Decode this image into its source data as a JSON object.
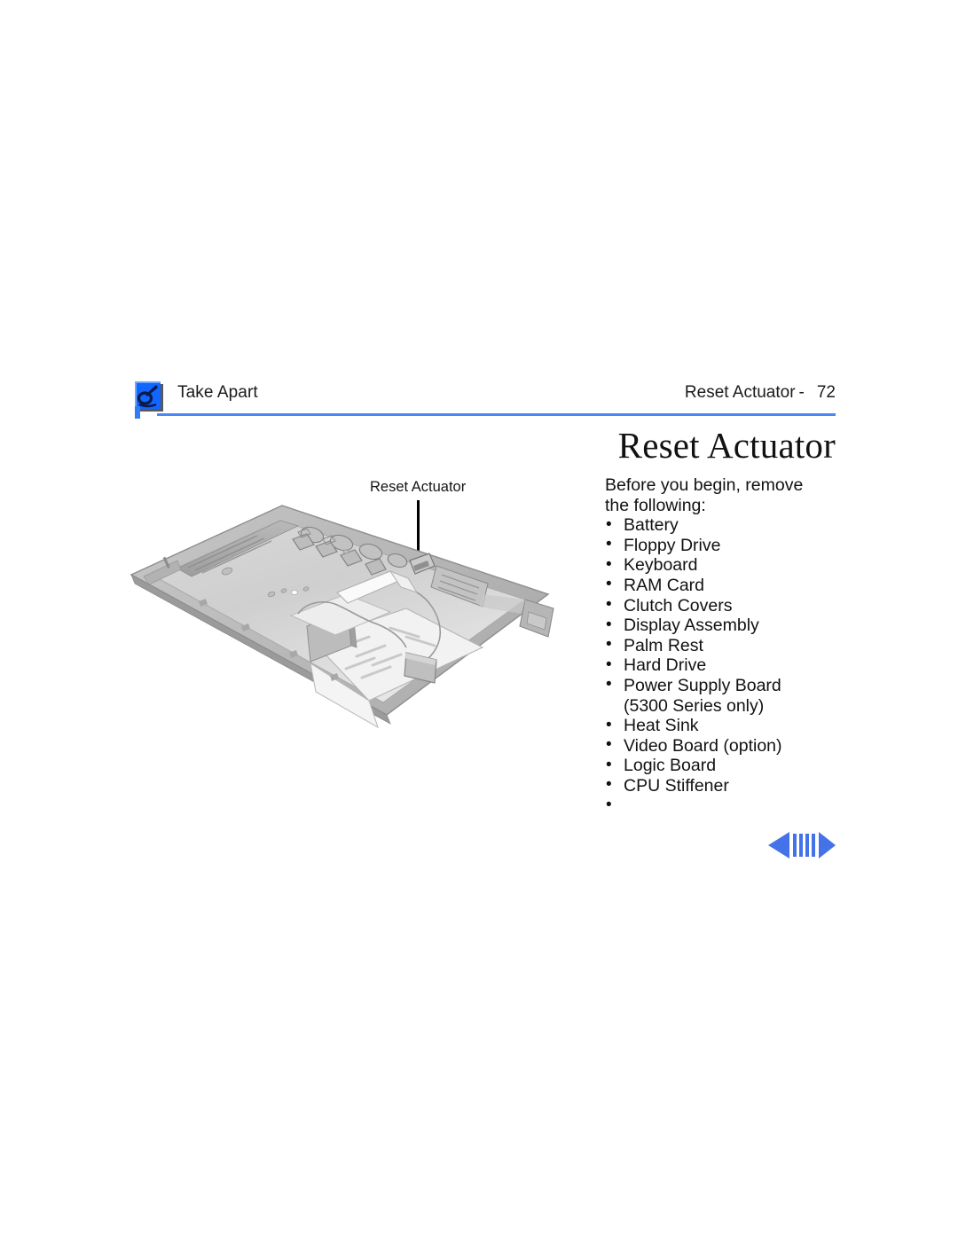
{
  "document": {
    "type": "service-manual-page",
    "page_number": "72"
  },
  "header": {
    "icon_name": "take-apart-tool-icon",
    "left_label": "Take Apart",
    "right_section": "Reset Actuator",
    "right_separator": "-",
    "right_page": "72",
    "rule_color": "#4a86f7"
  },
  "title": {
    "text": "Reset Actuator"
  },
  "intro": {
    "line1": "Before you begin, remove",
    "line2": "the following:"
  },
  "requirements": [
    {
      "label": "Battery",
      "continuation": false
    },
    {
      "label": "Floppy Drive",
      "continuation": false
    },
    {
      "label": "Keyboard",
      "continuation": false
    },
    {
      "label": "RAM Card",
      "continuation": false
    },
    {
      "label": "Clutch Covers",
      "continuation": false
    },
    {
      "label": "Display Assembly",
      "continuation": false
    },
    {
      "label": "Palm Rest",
      "continuation": false
    },
    {
      "label": "Hard Drive",
      "continuation": false
    },
    {
      "label": "Power Supply Board",
      "continuation": false
    },
    {
      "label": "(5300 Series only)",
      "continuation": true
    },
    {
      "label": "Heat Sink",
      "continuation": false
    },
    {
      "label": "Video Board (option)",
      "continuation": false
    },
    {
      "label": "Logic Board",
      "continuation": false
    },
    {
      "label": "CPU Stiffener",
      "continuation": false
    },
    {
      "label": "",
      "continuation": false
    }
  ],
  "figure": {
    "name": "powerbook-bottom-case-illustration",
    "callout_label": "Reset Actuator",
    "description": "Isometric grayscale illustration of a PowerBook bottom case with the reset actuator indicated by an arrow"
  },
  "navigation": {
    "previous_label": "previous-page-arrow",
    "next_label": "next-page-arrow",
    "accent_color": "#4472e8"
  }
}
